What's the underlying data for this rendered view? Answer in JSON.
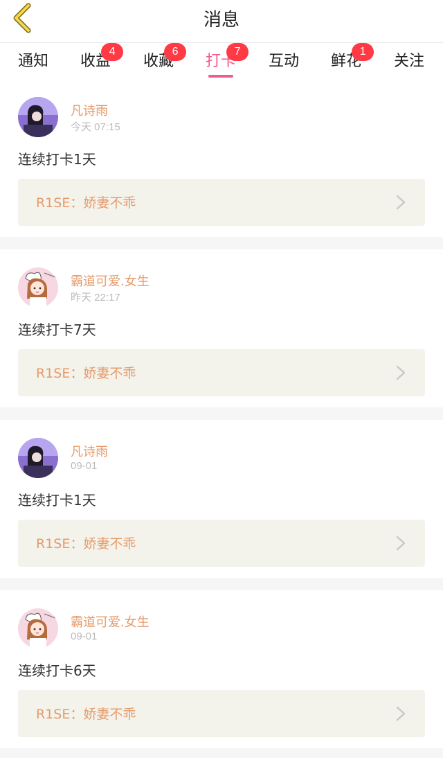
{
  "header": {
    "title": "消息"
  },
  "tabs": [
    {
      "label": "通知"
    },
    {
      "label": "收益",
      "badge": "4"
    },
    {
      "label": "收藏",
      "badge": "6"
    },
    {
      "label": "打卡",
      "badge": "7",
      "active": true
    },
    {
      "label": "互动"
    },
    {
      "label": "鲜花",
      "badge": "1"
    },
    {
      "label": "关注"
    }
  ],
  "feed": [
    {
      "name": "凡诗雨",
      "time": "今天 07:15",
      "desc": "连续打卡1天",
      "quote": "R1SE：娇妻不乖",
      "avatar": "purple-photo-avatar"
    },
    {
      "name": "霸道可爱.女生",
      "time": "昨天 22:17",
      "desc": "连续打卡7天",
      "quote": "R1SE：娇妻不乖",
      "avatar": "cartoon-girl-avatar"
    },
    {
      "name": "凡诗雨",
      "time": "09-01",
      "desc": "连续打卡1天",
      "quote": "R1SE：娇妻不乖",
      "avatar": "purple-photo-avatar"
    },
    {
      "name": "霸道可爱.女生",
      "time": "09-01",
      "desc": "连续打卡6天",
      "quote": "R1SE：娇妻不乖",
      "avatar": "cartoon-girl-avatar"
    }
  ],
  "colors": {
    "accent": "#f05a8c",
    "badge": "#ff3a45",
    "name": "#e59a6a",
    "quote_bg": "#f3f3ec"
  }
}
